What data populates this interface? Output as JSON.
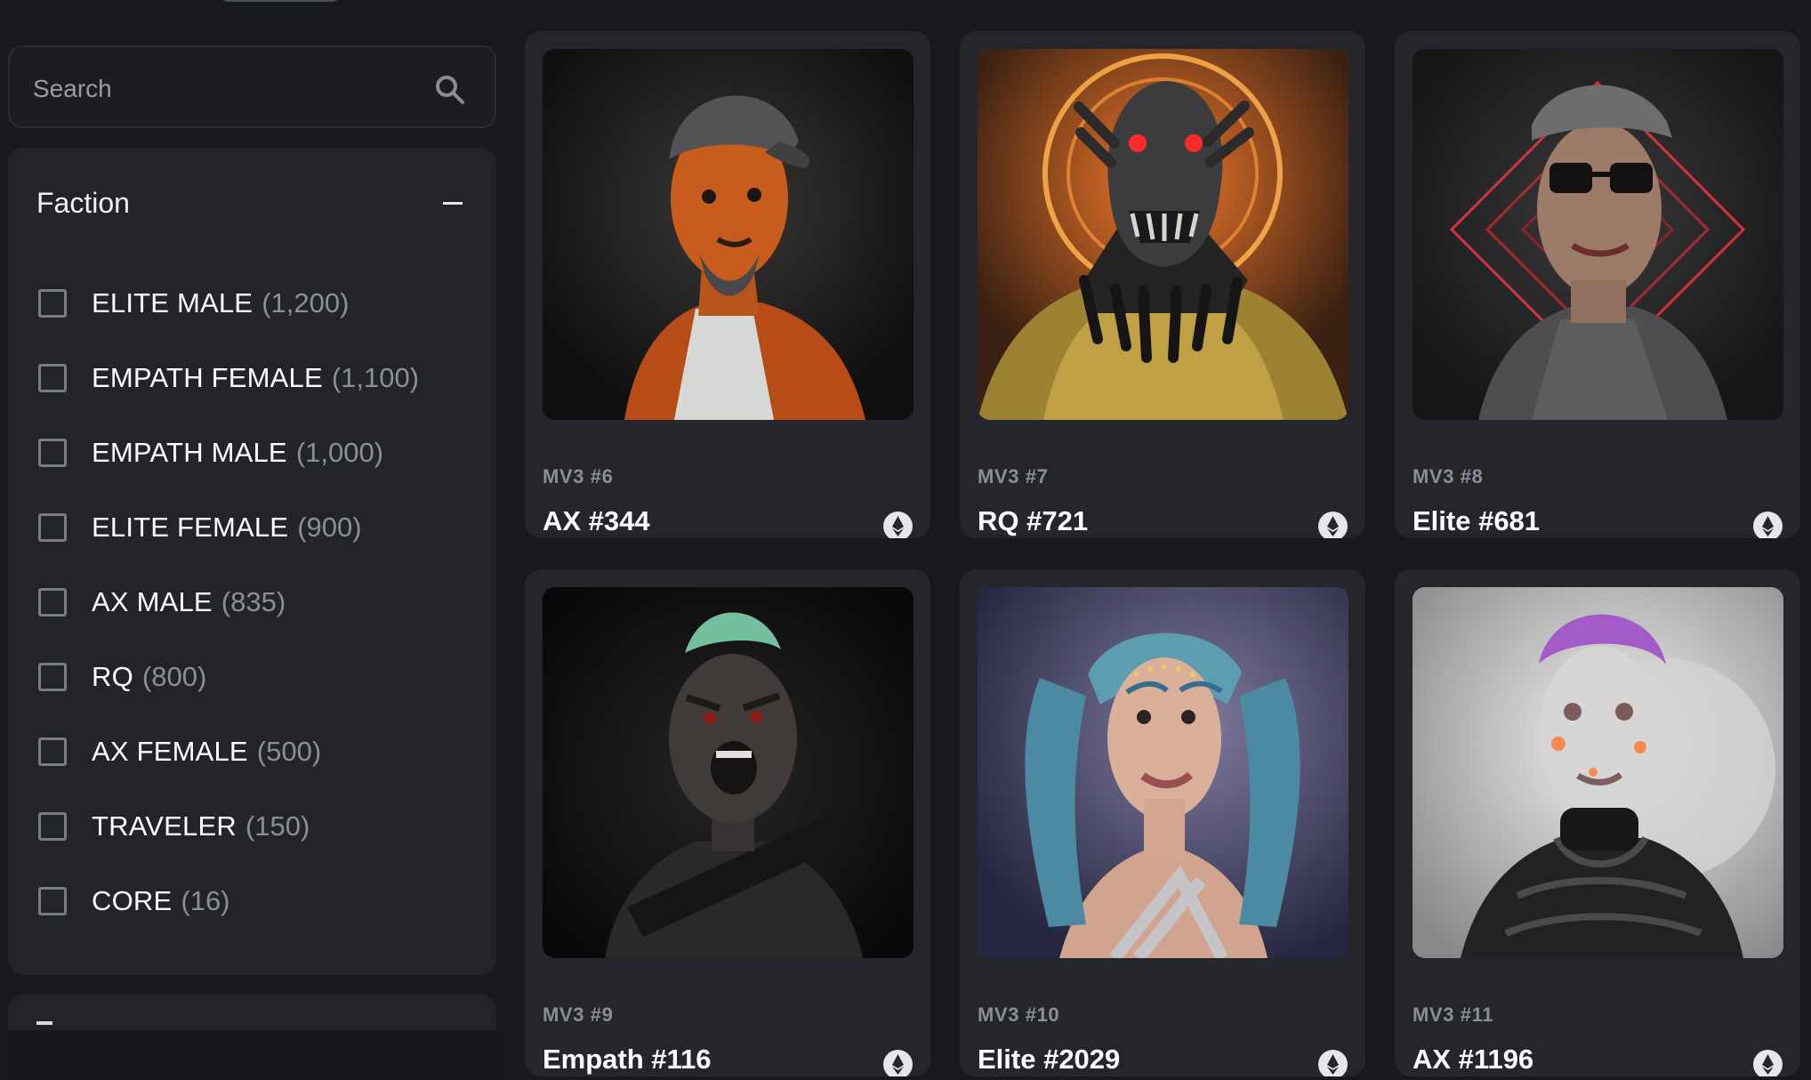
{
  "search": {
    "placeholder": "Search"
  },
  "filters": {
    "faction": {
      "title": "Faction",
      "items": [
        {
          "label": "ELITE MALE",
          "count": "(1,200)",
          "checked": false
        },
        {
          "label": "EMPATH FEMALE",
          "count": "(1,100)",
          "checked": false
        },
        {
          "label": "EMPATH MALE",
          "count": "(1,000)",
          "checked": false
        },
        {
          "label": "ELITE FEMALE",
          "count": "(900)",
          "checked": false
        },
        {
          "label": "AX MALE",
          "count": "(835)",
          "checked": false
        },
        {
          "label": "RQ",
          "count": "(800)",
          "checked": false
        },
        {
          "label": "AX FEMALE",
          "count": "(500)",
          "checked": false
        },
        {
          "label": "TRAVELER",
          "count": "(150)",
          "checked": false
        },
        {
          "label": "CORE",
          "count": "(16)",
          "checked": false
        }
      ]
    }
  },
  "cards": [
    {
      "collection": "MV3 #6",
      "name": "AX #344",
      "image_subject": "orange skinned male avatar with gray cap and white tank top",
      "background": "#101011"
    },
    {
      "collection": "MV3 #7",
      "name": "RQ #721",
      "image_subject": "spiky dark robotic creature with red eyes in yellow armor",
      "background": "#d2661f"
    },
    {
      "collection": "MV3 #8",
      "name": "Elite #681",
      "image_subject": "male avatar with sunglasses and newsboy cap against red geometric lines",
      "background": "#18181b"
    },
    {
      "collection": "MV3 #9",
      "name": "Empath #116",
      "image_subject": "dark skinned shouting avatar with green mohawk and rifle",
      "background": "#0c0c0d"
    },
    {
      "collection": "MV3 #10",
      "name": "Elite #2029",
      "image_subject": "female avatar with long blue pigtails and gold face jewels",
      "background": "#4d4b6f"
    },
    {
      "collection": "MV3 #11",
      "name": "AX #1196",
      "image_subject": "silver cyborg female with purple hair in black puffer jacket",
      "background": "#bfc0c1"
    }
  ],
  "theme": {
    "background": "#18191c",
    "panel": "#232429",
    "card": "#25262b",
    "muted_text": "#8d8f96",
    "text": "#ffffff"
  }
}
